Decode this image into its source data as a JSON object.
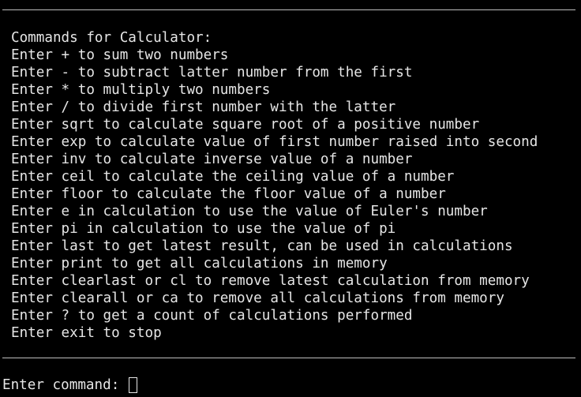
{
  "terminal": {
    "heading": "Commands for Calculator:",
    "lines": [
      "Enter + to sum two numbers",
      "Enter - to subtract latter number from the first",
      "Enter * to multiply two numbers",
      "Enter / to divide first number with the latter",
      "Enter sqrt to calculate square root of a positive number",
      "Enter exp to calculate value of first number raised into second",
      "Enter inv to calculate inverse value of a number",
      "Enter ceil to calculate the ceiling value of a number",
      "Enter floor to calculate the floor value of a number",
      "Enter e in calculation to use the value of Euler's number",
      "Enter pi in calculation to use the value of pi",
      "Enter last to get latest result, can be used in calculations",
      "Enter print to get all calculations in memory",
      "Enter clearlast or cl to remove latest calculation from memory",
      "Enter clearall or ca to remove all calculations from memory",
      "Enter ? to get a count of calculations performed",
      "Enter exit to stop"
    ],
    "prompt": "Enter command: ",
    "input_value": ""
  },
  "colors": {
    "background": "#000000",
    "text": "#e6e6e6",
    "rule": "#bdbdbd"
  }
}
